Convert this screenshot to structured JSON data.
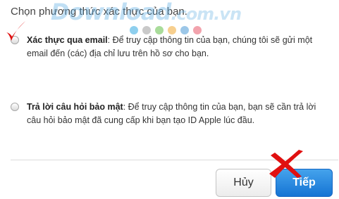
{
  "prompt": "Chọn phương thức xác thực của bạn.",
  "watermark": {
    "brand": "Download",
    "tld": ".com.vn"
  },
  "watermark_dot_colors": [
    "#8ecfee",
    "#c9c9c9",
    "#a9dc9a",
    "#f7cf8e",
    "#9cc7e8",
    "#f2a3ad"
  ],
  "options": [
    {
      "title": "Xác thực qua email",
      "description": ": Để truy cập thông tin của bạn, chúng tôi sẽ gửi một email đến (các) địa chỉ lưu trên hồ sơ cho bạn."
    },
    {
      "title": "Trả lời câu hỏi bảo mật",
      "description": ": Để truy cập thông tin của bạn, bạn sẽ cần trả lời câu hỏi bảo mật đã cung cấp khi bạn tạo ID Apple lúc đầu."
    }
  ],
  "buttons": {
    "cancel": "Hủy",
    "next": "Tiếp"
  },
  "annotation_color": "#e01010",
  "accent_color": "#1a7ad8"
}
